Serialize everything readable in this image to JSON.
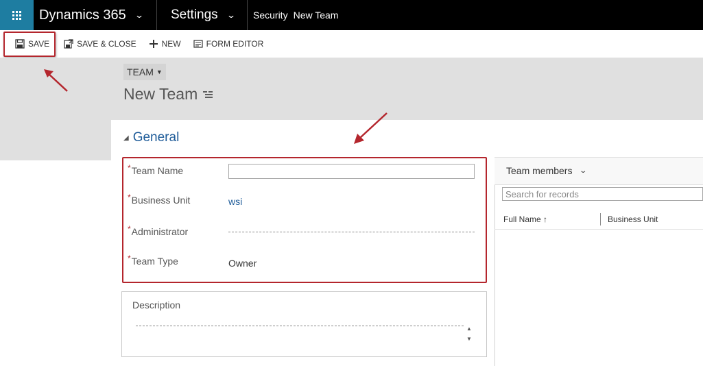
{
  "nav": {
    "app_title": "Dynamics 365",
    "area_title": "Settings",
    "breadcrumb": [
      "Security",
      "New Team"
    ]
  },
  "commands": {
    "save": "SAVE",
    "save_close": "SAVE & CLOSE",
    "new": "NEW",
    "form_editor": "FORM EDITOR"
  },
  "header": {
    "entity": "TEAM",
    "record_title": "New Team"
  },
  "section": {
    "title": "General"
  },
  "fields": [
    {
      "label": "Team Name",
      "value": ""
    },
    {
      "label": "Business Unit",
      "value": "wsi"
    },
    {
      "label": "Administrator",
      "value": ""
    },
    {
      "label": "Team Type",
      "value": "Owner"
    }
  ],
  "required_marker": "*",
  "description": {
    "label": "Description",
    "value": ""
  },
  "subgrid": {
    "title": "Team members",
    "search_placeholder": "Search for records",
    "columns": [
      "Full Name",
      "Business Unit"
    ],
    "sort_indicator": "↑"
  },
  "colors": {
    "topbar": "#000000",
    "waffle": "#1e7da1",
    "accent_red": "#b4262d",
    "link": "#1f5c99",
    "header_band": "#e0e0e0"
  },
  "icons": [
    "waffle-icon",
    "chevron-down-icon",
    "save-icon",
    "save-close-icon",
    "plus-icon",
    "form-editor-icon",
    "caret-down-icon",
    "hamburger-icon",
    "collapse-triangle-icon",
    "spinner-icon",
    "sort-up-icon",
    "annotation-arrow"
  ]
}
